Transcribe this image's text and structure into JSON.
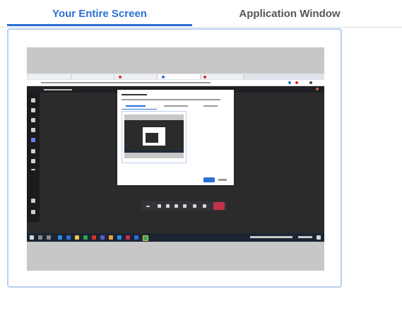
{
  "tabs": {
    "entire_screen_label": "Your Entire Screen",
    "application_window_label": "Application Window",
    "selected": "Your Entire Screen"
  },
  "colors": {
    "accent": "#2b6fd6",
    "inactive_tab_text": "#555555",
    "card_border": "#b9cff0",
    "thumbnail_background": "#c7c7c7",
    "desktop_background": "#2b2b2b",
    "hangup_red": "#c4314b",
    "taskbar": "#1b2533"
  },
  "preview": {
    "icon": "screen-preview-thumbnail"
  }
}
